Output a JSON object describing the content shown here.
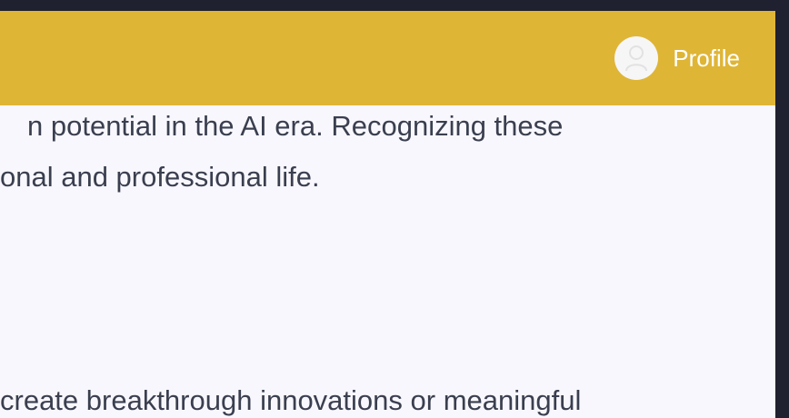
{
  "header": {
    "profile_label": "Profile",
    "profile_icon": "user-avatar-icon",
    "background_color": "#dfb536"
  },
  "content": {
    "lines": [
      "n potential in the AI era. Recognizing these",
      "onal and professional life.",
      "create breakthrough innovations or meaningful"
    ],
    "text_color": "#3a3f4f",
    "background_color": "#f8f7fe"
  }
}
